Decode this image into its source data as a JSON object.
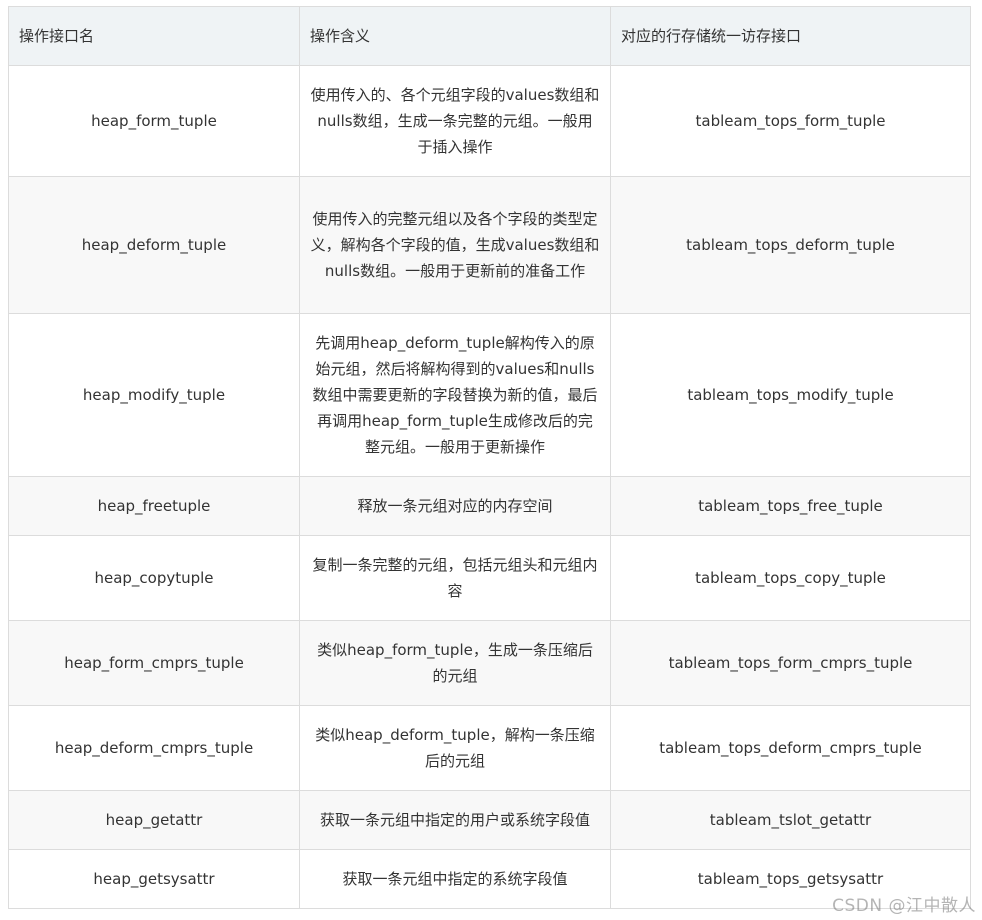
{
  "table": {
    "headers": [
      "操作接口名",
      "操作含义",
      "对应的行存储统一访存接口"
    ],
    "rows": [
      {
        "name": "heap_form_tuple",
        "meaning": "使用传入的、各个元组字段的values数组和nulls数组，生成一条完整的元组。一般用于插入操作",
        "interface": "tableam_tops_form_tuple"
      },
      {
        "name": "heap_deform_tuple",
        "meaning": "使用传入的完整元组以及各个字段的类型定义，解构各个字段的值，生成values数组和nulls数组。一般用于更新前的准备工作",
        "interface": "tableam_tops_deform_tuple"
      },
      {
        "name": "heap_modify_tuple",
        "meaning": "先调用heap_deform_tuple解构传入的原始元组，然后将解构得到的values和nulls数组中需要更新的字段替换为新的值，最后再调用heap_form_tuple生成修改后的完整元组。一般用于更新操作",
        "interface": "tableam_tops_modify_tuple"
      },
      {
        "name": "heap_freetuple",
        "meaning": "释放一条元组对应的内存空间",
        "interface": "tableam_tops_free_tuple"
      },
      {
        "name": "heap_copytuple",
        "meaning": "复制一条完整的元组，包括元组头和元组内容",
        "interface": "tableam_tops_copy_tuple"
      },
      {
        "name": "heap_form_cmprs_tuple",
        "meaning": "类似heap_form_tuple，生成一条压缩后的元组",
        "interface": "tableam_tops_form_cmprs_tuple"
      },
      {
        "name": "heap_deform_cmprs_tuple",
        "meaning": "类似heap_deform_tuple，解构一条压缩后的元组",
        "interface": "tableam_tops_deform_cmprs_tuple"
      },
      {
        "name": "heap_getattr",
        "meaning": "获取一条元组中指定的用户或系统字段值",
        "interface": "tableam_tslot_getattr"
      },
      {
        "name": "heap_getsysattr",
        "meaning": "获取一条元组中指定的系统字段值",
        "interface": "tableam_tops_getsysattr"
      }
    ]
  },
  "watermark": "CSDN @江中散人"
}
